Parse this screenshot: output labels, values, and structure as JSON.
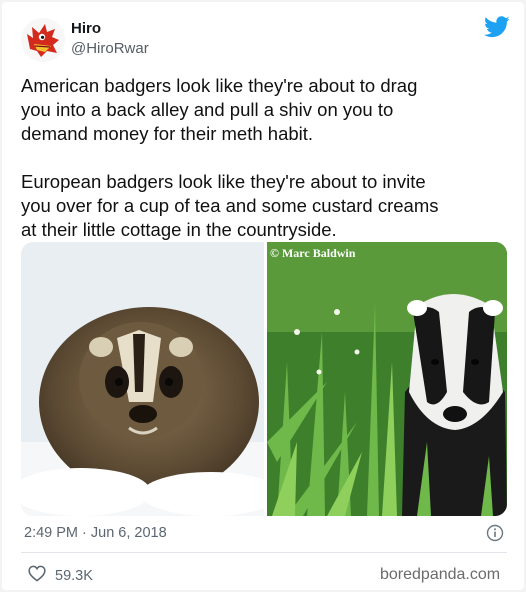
{
  "author": {
    "name": "Hiro",
    "handle": "@HiroRwar"
  },
  "tweet": {
    "paragraph_1": "American badgers look like they're about to drag\nyou into a back alley and pull a shiv on you to\ndemand money for their meth habit.",
    "paragraph_2": "European badgers look like they're about to invite\nyou over for a cup of tea and some custard creams\nat their little cottage in the countryside."
  },
  "images": {
    "right_credit": "© Marc Baldwin"
  },
  "meta": {
    "timestamp": "2:49 PM · Jun 6, 2018",
    "likes": "59.3K"
  },
  "watermark": "boredpanda.com",
  "icons": [
    "avatar-dragon",
    "twitter-bird-icon",
    "info-icon",
    "heart-icon"
  ],
  "colors": {
    "twitter_blue": "#1da1f2",
    "avatar_red": "#d42a1e"
  }
}
